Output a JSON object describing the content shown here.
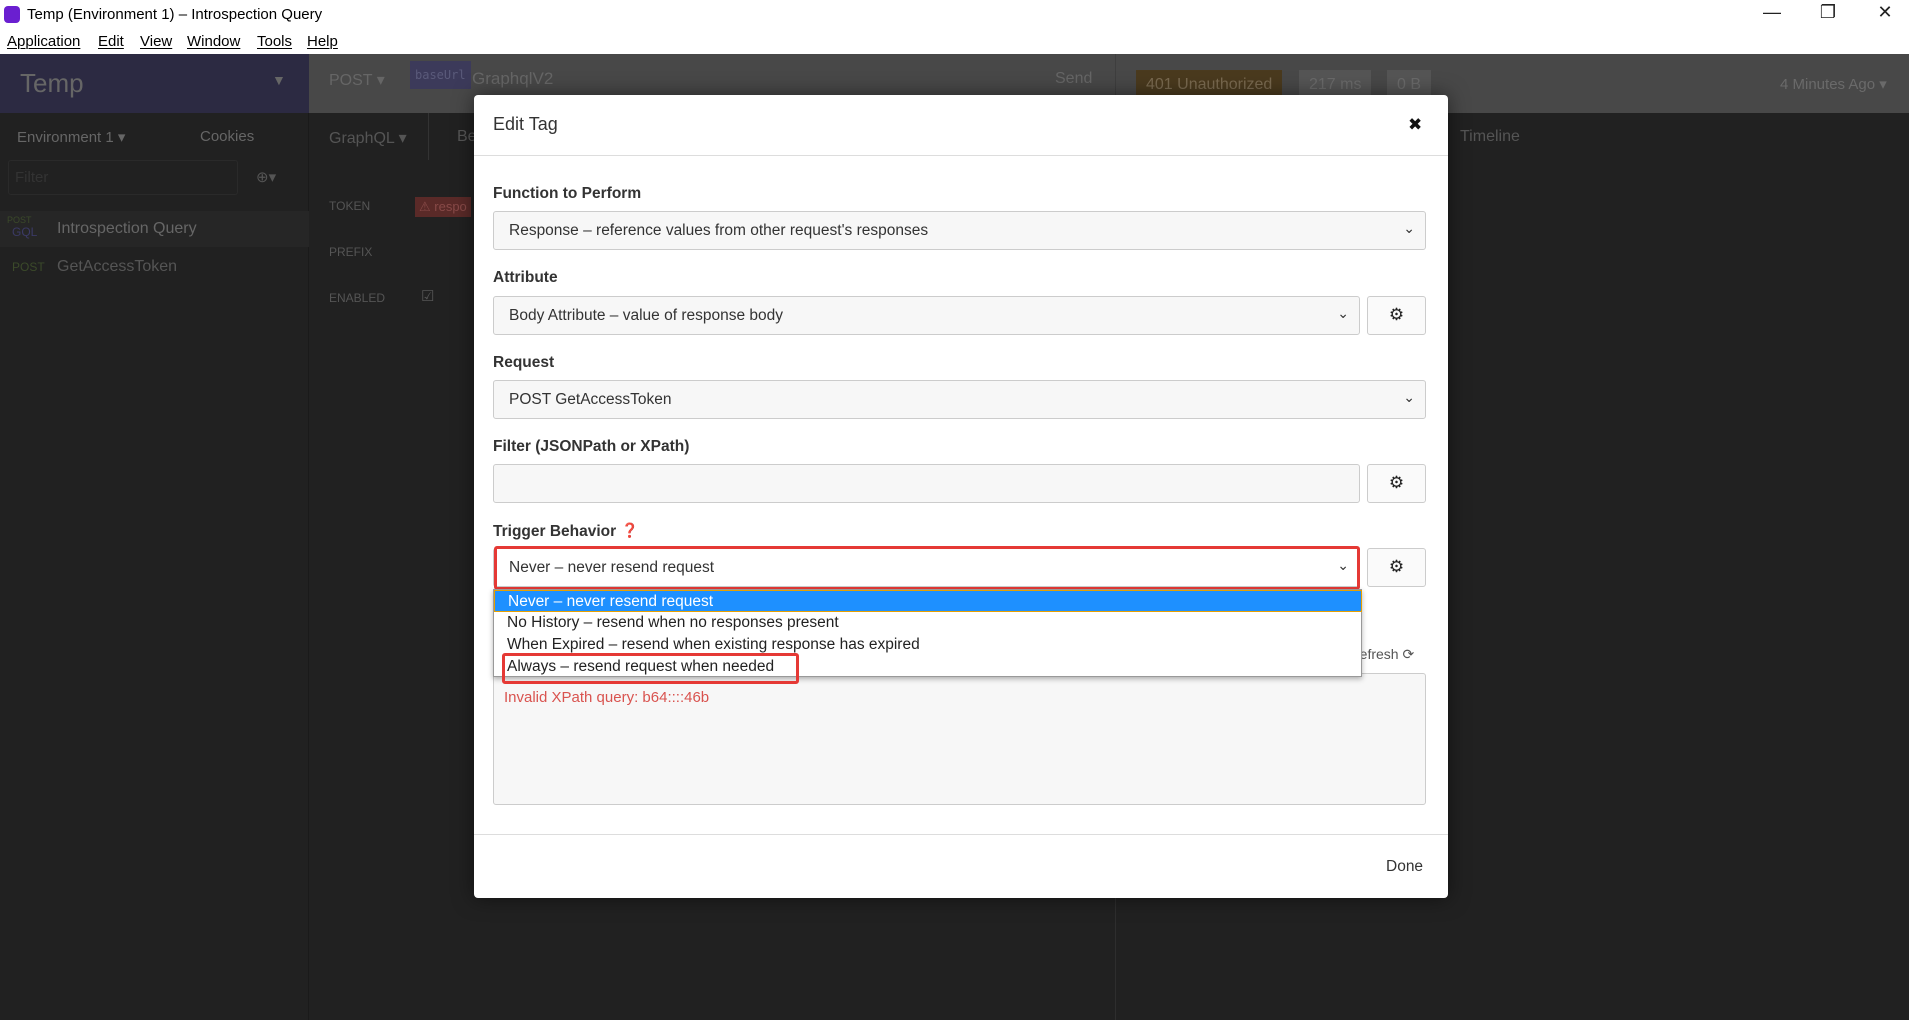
{
  "window": {
    "title": "Temp (Environment 1) – Introspection Query",
    "minimize": "—",
    "restore": "❐",
    "close": "✕"
  },
  "menu": [
    "Application",
    "Edit",
    "View",
    "Window",
    "Tools",
    "Help"
  ],
  "sidebar": {
    "workspace": "Temp",
    "environment": "Environment 1 ▾",
    "cookies": "Cookies",
    "filter_placeholder": "Filter",
    "requests": [
      {
        "method_top": "POST",
        "method": "GQL",
        "name": "Introspection Query"
      },
      {
        "method": "POST",
        "name": "GetAccessToken"
      }
    ]
  },
  "request_bar": {
    "method": "POST ▾",
    "base_url_tag": "baseUrl",
    "url": "GraphqlV2",
    "send": "Send"
  },
  "request_tabs": {
    "body": "GraphQL ▾",
    "auth": "Be"
  },
  "auth": {
    "token_label": "TOKEN",
    "token_tag": "⚠ respo",
    "prefix_label": "PREFIX",
    "enabled_label": "ENABLED"
  },
  "response": {
    "status": "401 Unauthorized",
    "time": "217 ms",
    "size": "0 B",
    "history": "4 Minutes Ago ▾",
    "tab_timeline": "Timeline"
  },
  "modal": {
    "title": "Edit Tag",
    "close": "✖",
    "function_label": "Function to Perform",
    "function_value": "Response – reference values from other request's responses",
    "attribute_label": "Attribute",
    "attribute_value": "Body Attribute – value of response body",
    "request_label": "Request",
    "request_value": "POST GetAccessToken",
    "filter_label": "Filter (JSONPath or XPath)",
    "filter_value": "",
    "trigger_label": "Trigger Behavior",
    "trigger_value": "Never – never resend request",
    "trigger_options": [
      "Never – never resend request",
      "No History – resend when no responses present",
      "When Expired – resend when existing response has expired",
      "Always – resend request when needed"
    ],
    "refresh": "refresh",
    "preview_error": "Invalid XPath query: b64::::46b",
    "done": "Done"
  },
  "colors": {
    "highlight": "#e53935",
    "selected_option": "#1e90ff",
    "error": "#d9534f"
  }
}
